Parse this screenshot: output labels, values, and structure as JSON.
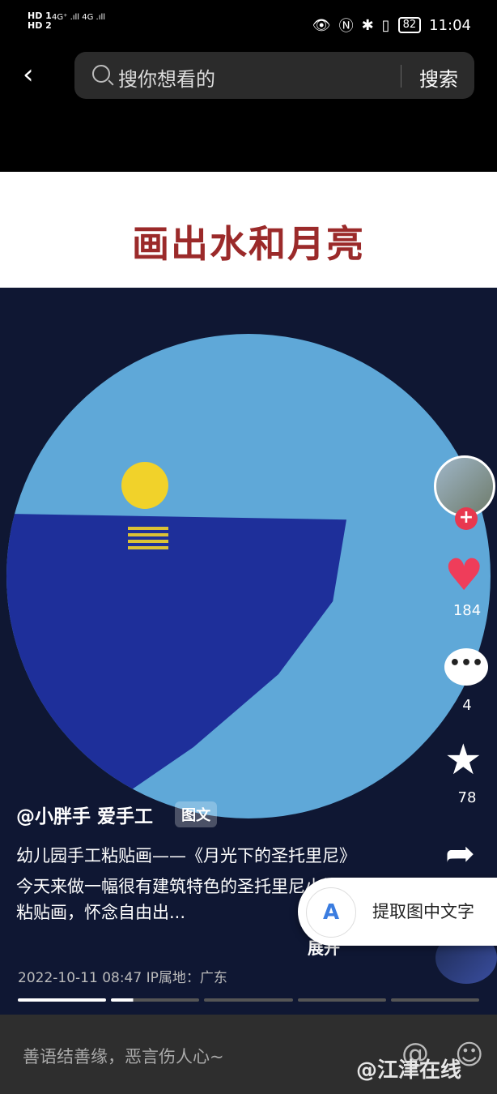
{
  "status": {
    "left_lines": [
      "HD 1",
      "HD 2"
    ],
    "signal": "4G⁺ .ıll 4G .ıll",
    "battery": "82",
    "time": "11:04"
  },
  "topbar": {
    "search_placeholder": "搜你想看的",
    "search_button": "搜索"
  },
  "photo": {
    "title": "画出水和月亮"
  },
  "side": {
    "likes": "184",
    "comments": "4",
    "favorites": "78"
  },
  "post": {
    "author": "@小胖手 爱手工",
    "tag": "图文",
    "desc": "幼儿园手工粘贴画——《月光下的圣托里尼》",
    "desc2": "今天来做一幅很有建筑特色的圣托里尼小镇粘贴画，怀念自由出...",
    "more": "展开",
    "meta": "2022-10-11 08:47  IP属地：广东"
  },
  "ocr": {
    "label": "提取图中文字"
  },
  "bottom": {
    "placeholder": "善语结善缘，恶言伤人心~"
  },
  "watermark": "@江津在线",
  "colors": {
    "accent_red": "#e8384f",
    "title_red": "#9b2a2a"
  }
}
